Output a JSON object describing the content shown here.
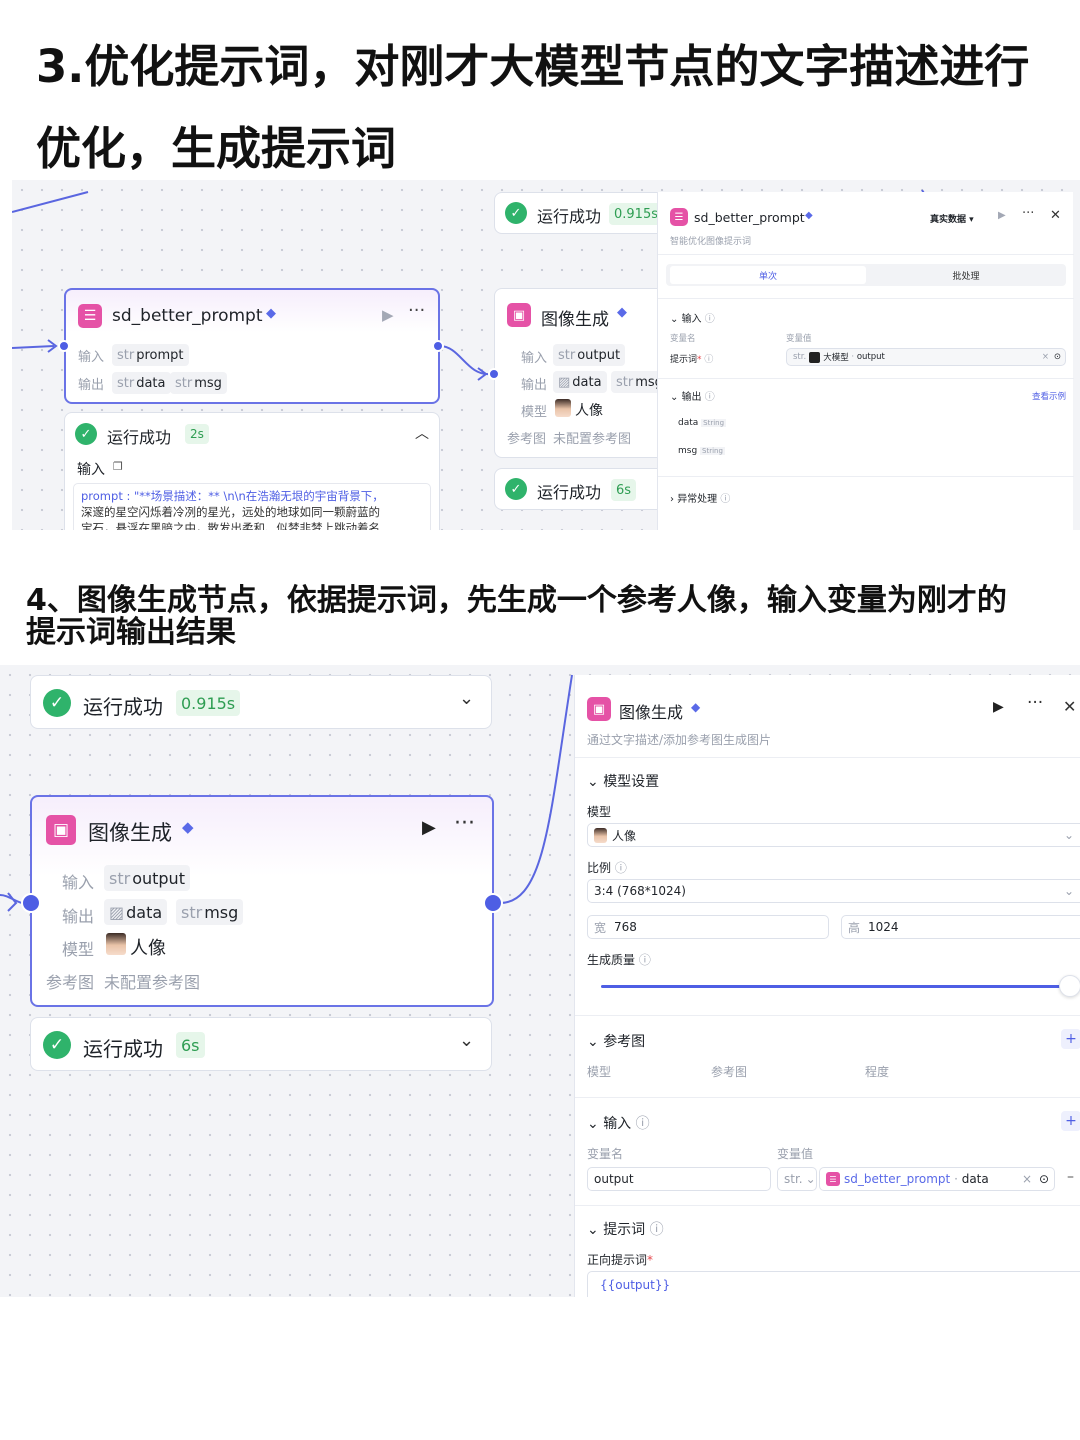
{
  "section3": {
    "heading_line1": "3.优化提示词，对刚才大模型节点的文字描述进行",
    "heading_line2": "优化，生成提示词",
    "top_status": {
      "text": "运行成功",
      "time": "0.915s"
    },
    "node_prompt": {
      "title": "sd_better_prompt",
      "input_label": "输入",
      "input_type": "str",
      "input_var": "prompt",
      "output_label": "输出",
      "output_type": "str",
      "output_var1": "data",
      "output_var2": "msg"
    },
    "node_prompt_status": {
      "text": "运行成功",
      "time": "2s",
      "input_label": "输入",
      "prompt_text_line1": "prompt : \"**场景描述：** \\n\\n在浩瀚无垠的宇宙背景下，",
      "prompt_text_line2": "深邃的星空闪烁着冷冽的星光，远处的地球如同一颗蔚蓝的",
      "prompt_text_line3": "宝石，悬浮在黑暗之中，散发出柔和、似梦非梦上跳动着名"
    },
    "node_image": {
      "title": "图像生成",
      "input_label": "输入",
      "input_type": "str",
      "input_var": "output",
      "output_label": "输出",
      "output_var1": "data",
      "output_type2": "str",
      "output_var2": "msg",
      "model_label": "模型",
      "model_value": "人像",
      "ref_label": "参考图",
      "ref_value": "未配置参考图"
    },
    "node_image_status": {
      "text": "运行成功",
      "time": "6s"
    },
    "panel": {
      "title": "sd_better_prompt",
      "subtitle": "智能优化图像提示词",
      "data_mode": "真实数据",
      "tab_single": "单次",
      "tab_batch": "批处理",
      "input_section": "输入",
      "col_name": "变量名",
      "col_value": "变量值",
      "prompt_label": "提示词",
      "value_type": "str.",
      "value_source": "大模型",
      "value_field": "output",
      "output_section": "输出",
      "view_example": "查看示例",
      "out1_name": "data",
      "out1_type": "String",
      "out2_name": "msg",
      "out2_type": "String",
      "exception_section": "异常处理"
    }
  },
  "section4": {
    "heading_line1": "4、图像生成节点，依据提示词，先生成一个参考人像，输入变量为刚才的",
    "heading_line2": "提示词输出结果",
    "top_status": {
      "text": "运行成功",
      "time": "0.915s"
    },
    "node_image": {
      "title": "图像生成",
      "input_label": "输入",
      "input_type": "str",
      "input_var": "output",
      "output_label": "输出",
      "output_var1": "data",
      "output_type2": "str",
      "output_var2": "msg",
      "model_label": "模型",
      "model_value": "人像",
      "ref_label": "参考图",
      "ref_value": "未配置参考图"
    },
    "node_image_status": {
      "text": "运行成功",
      "time": "6s"
    },
    "panel": {
      "title": "图像生成",
      "subtitle": "通过文字描述/添加参考图生成图片",
      "model_settings": "模型设置",
      "model_label": "模型",
      "model_value": "人像",
      "ratio_label": "比例",
      "ratio_value": "3:4 (768*1024)",
      "width_label": "宽",
      "width_value": "768",
      "height_label": "高",
      "height_value": "1024",
      "quality_label": "生成质量",
      "quality_fraction": 0.98,
      "ref_section": "参考图",
      "ref_col_model": "模型",
      "ref_col_image": "参考图",
      "ref_col_level": "程度",
      "input_section": "输入",
      "col_name": "变量名",
      "col_value": "变量值",
      "var_name": "output",
      "var_type": "str.",
      "var_source": "sd_better_prompt",
      "var_field": "data",
      "prompt_section": "提示词",
      "positive_label": "正向提示词",
      "positive_value": "{{output}}"
    }
  },
  "colors": {
    "accent": "#4e5ee4",
    "success": "#2fb36b",
    "node_icon": "#e552a6"
  }
}
